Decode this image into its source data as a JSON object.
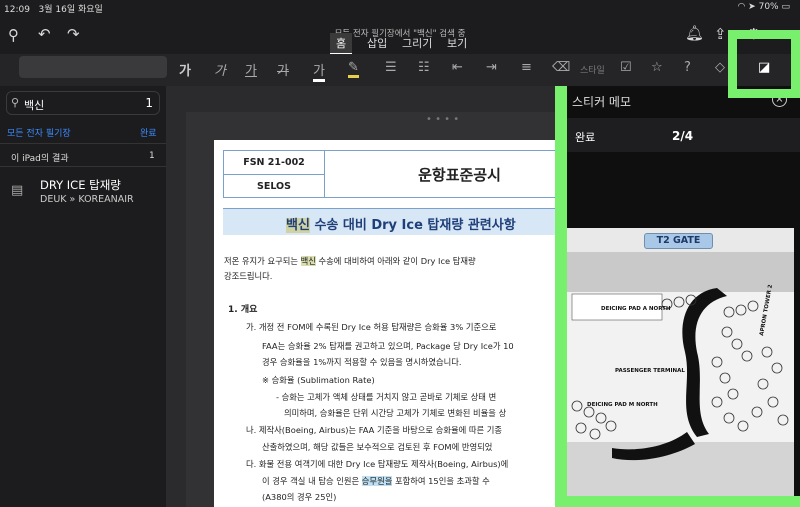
{
  "statusbar": {
    "time": "12:09",
    "date": "3월 16일 화요일",
    "battery": "70%"
  },
  "topbar": {
    "search_status": "모든 전자 필기장에서 \"백신\" 검색 중",
    "tabs": [
      {
        "label": "홈",
        "active": true
      },
      {
        "label": "삽입",
        "active": false
      },
      {
        "label": "그리기",
        "active": false
      },
      {
        "label": "보기",
        "active": false
      }
    ]
  },
  "toolbar": {
    "font_styles": [
      "가",
      "가",
      "가",
      "가",
      "가"
    ],
    "style_label": "스타일"
  },
  "sidebar": {
    "search_value": "백신",
    "search_count": "1",
    "scope_label": "모든 전자 필기장",
    "done_label": "완료",
    "section_label": "이 iPad의 결과",
    "section_count": "1",
    "result": {
      "title": "DRY ICE 탑재량",
      "path": "DEUK » KOREANAIR"
    }
  },
  "document": {
    "header": {
      "code": "FSN 21-002",
      "org": "SELOS",
      "title": "운항표준공시"
    },
    "subject_prefix": "백신",
    "subject_rest": " 수송 대비 Dry Ice 탑재량 관련사항 ",
    "intro_1_pre": "저온 유지가 요구되는 ",
    "intro_1_hl": "백신",
    "intro_1_post": " 수송에 대비하여 아래와 같이 Dry Ice 탑재량",
    "intro_2": "강조드립니다.",
    "section_1": "1. 개요",
    "item_a_1": "가. 개정 전 FOM에 수록된 Dry Ice 허용 탑재량은 승화율 3% 기준으로",
    "item_a_2": "FAA는 승화율 2% 탑재를 권고하고 있으며, Package 당 Dry Ice가 10",
    "item_a_3": "경우 승화율을 1%까지 적용할 수 있음을 명시하였습니다.",
    "note_1": "※ 승화율 (Sublimation Rate)",
    "note_2": "- 승화는 고체가 액체 상태를 거치지 않고 곧바로 기체로 상태 변",
    "note_3": "의미하며, 승화율은 단위 시간당 고체가 기체로 변화된 비율을 상",
    "item_b_1": "나. 제작사(Boeing, Airbus)는 FAA 기준을 바탕으로 승화율에 따른 기종",
    "item_b_2": "산출하였으며, 해당 값들은 보수적으로 검토된 후 FOM에 반영되었",
    "item_c_1": "다. 화물 전용 여객기에 대한 Dry Ice 탑재량도 제작사(Boeing, Airbus)에",
    "item_c_2_pre": "이 경우 객실 내 탑승 인원은 ",
    "item_c_2_hl": "승무원을",
    "item_c_2_post": " 포함하여 15인을 초과할 수",
    "item_c_3": "(A380의 경우 25인)"
  },
  "sticker": {
    "title": "스티커 메모",
    "done_label": "완료",
    "page": "2/4",
    "map": {
      "gate_label": "T2 GATE",
      "deicing_north": "DEICING PAD A NORTH",
      "terminal": "PASSENGER TERMINAL 2",
      "deicing_m": "DEICING PAD M NORTH",
      "apron": "APRON TOWER 2"
    }
  },
  "colors": {
    "highlight_green": "#78f06e",
    "doc_header_border": "#7aa1c9",
    "subject_band": "#d7e7f5"
  }
}
